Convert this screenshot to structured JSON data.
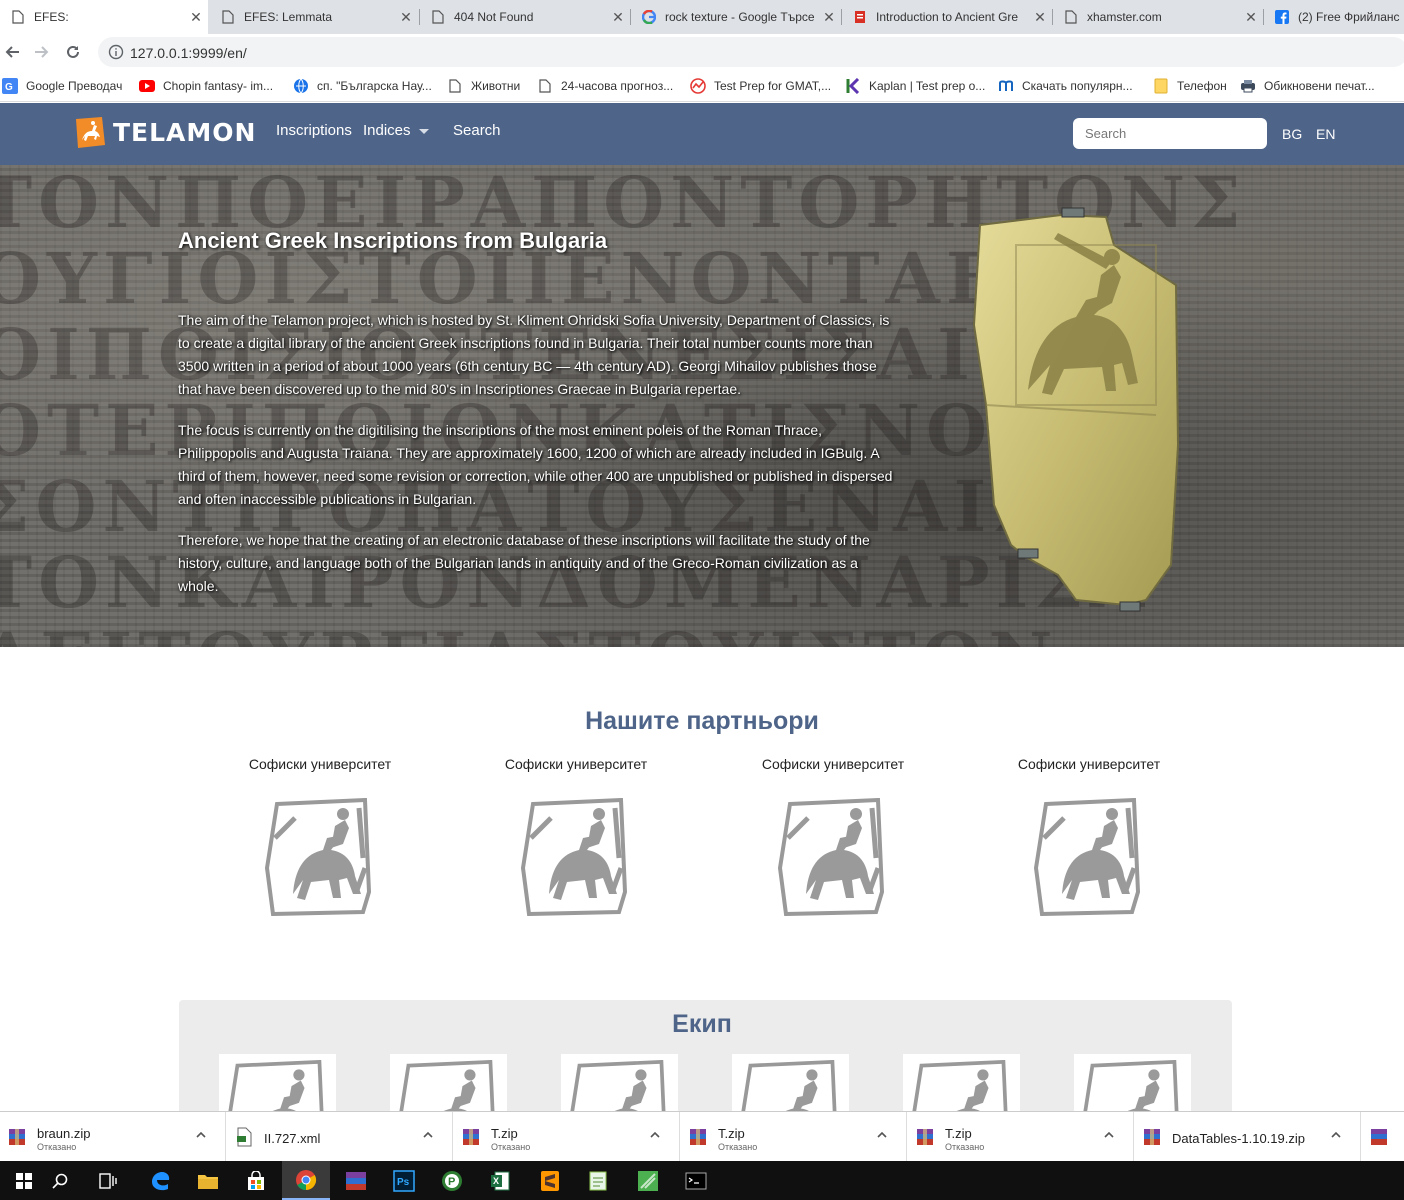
{
  "browser": {
    "tabs": [
      {
        "title": "EFES:",
        "active": true
      },
      {
        "title": "EFES: Lemmata",
        "active": false
      },
      {
        "title": "404 Not Found",
        "active": false
      },
      {
        "title": "rock texture - Google Търсе",
        "active": false
      },
      {
        "title": "Introduction to Ancient Gre",
        "active": false
      },
      {
        "title": "xhamster.com",
        "active": false
      },
      {
        "title": "(2) Free Фрийланс",
        "active": false
      }
    ],
    "url": "127.0.0.1:9999/en/",
    "bookmarks": [
      {
        "label": "Google Преводач",
        "icon": "google-translate-icon"
      },
      {
        "label": "Chopin fantasy- im...",
        "icon": "youtube-icon"
      },
      {
        "label": "сп. \"Българска Нау...",
        "icon": "globe-icon"
      },
      {
        "label": "Животни",
        "icon": "page-icon"
      },
      {
        "label": "24-часова прогноз...",
        "icon": "page-icon"
      },
      {
        "label": "Test Prep for GMAT,...",
        "icon": "chart-icon"
      },
      {
        "label": "Kaplan | Test prep o...",
        "icon": "kaplan-icon"
      },
      {
        "label": "Скачать популярн...",
        "icon": "m-icon"
      },
      {
        "label": "Телефон",
        "icon": "folder-icon"
      },
      {
        "label": "Обикновени печат...",
        "icon": "printer-icon"
      }
    ]
  },
  "site": {
    "logo_text": "TELAMON",
    "nav": {
      "inscriptions": "Inscriptions",
      "indices": "Indices",
      "search": "Search"
    },
    "search_placeholder": "Search",
    "lang_bg": "BG",
    "lang_en": "EN"
  },
  "hero": {
    "title": "Ancient Greek Inscriptions from Bulgaria",
    "paragraphs": [
      "The aim of the Telamon project, which is hosted by St. Kliment Ohridski Sofia University, Department of Classics, is to create a digital library of the ancient Greek inscriptions found in Bulgaria. Their total number counts more than 3500 written in a period of about 1000 years (6th century BC — 4th century AD). Georgi Mihailov publishes those that have been discovered up to the mid 80's in Inscriptiones Graecae in Bulgaria repertae.",
      "The focus is currently on the digitilising the inscriptions of the most eminent poleis of the Roman Thrace, Philippopolis and Augusta Traiana. They are approximately 1600, 1200 of which are already included in IGBulg. A third of them, however, need some revision or correction, while other 400 are unpublished or published in dispersed and often inaccessible publications in Bulgarian.",
      "Therefore, we hope that the creating of an electronic database of these inscriptions will facilitate the study of the history, culture, and language both of the Bulgarian lands in antiquity and of the Greco-Roman civilization as a whole."
    ]
  },
  "partners": {
    "title": "Нашите партньори",
    "items": [
      {
        "name": "Софиски университет"
      },
      {
        "name": "Софиски университет"
      },
      {
        "name": "Софиски университет"
      },
      {
        "name": "Софиски университет"
      }
    ]
  },
  "team": {
    "title": "Екип",
    "member_count": 6
  },
  "downloads": [
    {
      "name": "braun.zip",
      "status": "Отказано",
      "icon": "archive-icon"
    },
    {
      "name": "II.727.xml",
      "status": "",
      "icon": "xml-file-icon"
    },
    {
      "name": "T.zip",
      "status": "Отказано",
      "icon": "archive-icon"
    },
    {
      "name": "T.zip",
      "status": "Отказано",
      "icon": "archive-icon"
    },
    {
      "name": "T.zip",
      "status": "Отказано",
      "icon": "archive-icon"
    },
    {
      "name": "DataTables-1.10.19.zip",
      "status": "",
      "icon": "archive-icon"
    }
  ],
  "taskbar": [
    "windows-start-icon",
    "search-icon",
    "task-view-icon",
    "edge-icon",
    "file-explorer-icon",
    "store-icon",
    "chrome-icon",
    "winrar-icon",
    "photoshop-icon",
    "app-p-icon",
    "excel-icon",
    "sublime-icon",
    "notepad-icon",
    "app-green-icon",
    "cmd-icon"
  ],
  "colors": {
    "nav_bg": "#4e6488",
    "heading": "#4e6488",
    "team_bg": "#ececec"
  }
}
